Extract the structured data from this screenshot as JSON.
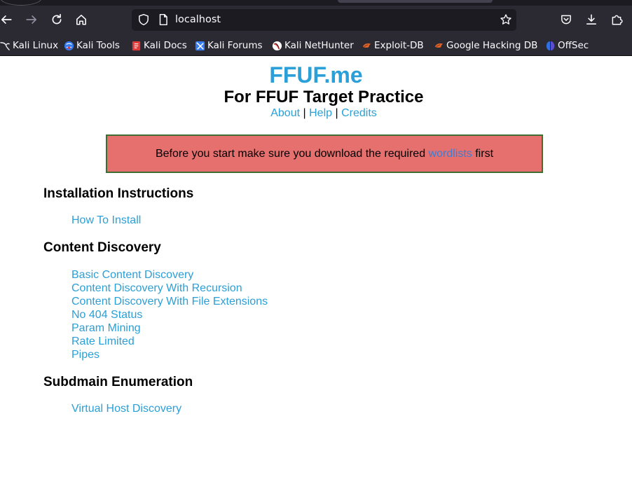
{
  "browser": {
    "url": "localhost",
    "bookmarks": [
      {
        "label": "Kali Linux",
        "icon": "kali-dragon-icon"
      },
      {
        "label": "Kali Tools",
        "icon": "kali-tools-icon"
      },
      {
        "label": "Kali Docs",
        "icon": "kali-docs-icon"
      },
      {
        "label": "Kali Forums",
        "icon": "kali-forums-icon"
      },
      {
        "label": "Kali NetHunter",
        "icon": "kali-nethunter-icon"
      },
      {
        "label": "Exploit-DB",
        "icon": "exploit-db-icon"
      },
      {
        "label": "Google Hacking DB",
        "icon": "ghdb-icon"
      },
      {
        "label": "OffSec",
        "icon": "offsec-icon"
      }
    ]
  },
  "page": {
    "title": "FFUF.me",
    "subtitle": "For FFUF Target Practice",
    "nav": {
      "about": "About",
      "help": "Help",
      "credits": "Credits",
      "separator": "|"
    },
    "notice": {
      "before": "Before you start make sure you download the required",
      "link": "wordlists",
      "after": "first"
    },
    "sections": [
      {
        "title": "Installation Instructions",
        "links": [
          "How To Install"
        ]
      },
      {
        "title": "Content Discovery",
        "links": [
          "Basic Content Discovery",
          "Content Discovery With Recursion",
          "Content Discovery With File Extensions",
          "No 404 Status",
          "Param Mining",
          "Rate Limited",
          "Pipes"
        ]
      },
      {
        "title": "Subdmain Enumeration",
        "links": [
          "Virtual Host Discovery"
        ]
      }
    ]
  },
  "colors": {
    "link": "#2b9fd7",
    "notice_bg": "#e6706e",
    "notice_border": "#3e6e34",
    "chrome_bg": "#2b2a33",
    "urlbar_bg": "#1c1b22"
  }
}
